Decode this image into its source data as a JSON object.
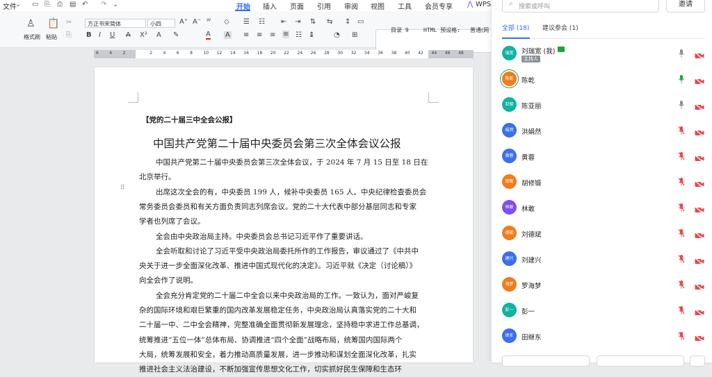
{
  "menubar": {
    "file": "文件",
    "tabs": [
      "开始",
      "插入",
      "页面",
      "引用",
      "审阅",
      "视图",
      "工具",
      "会员专享"
    ],
    "active_tab": "开始",
    "wps_ai": "WPS AI"
  },
  "ribbon": {
    "format_painter": "格式刷",
    "paste": "粘贴",
    "font_name": "方正书宋简体",
    "font_size": "小四",
    "style_name": "目录 9",
    "html_preset_label": "HTML 预设格:",
    "html_preset_value": "普通(网"
  },
  "ruler": {
    "ticks": [
      "6",
      "4",
      "2",
      "",
      "2",
      "4",
      "6",
      "8",
      "10",
      "12",
      "14",
      "16",
      "18",
      "20",
      "22",
      "24",
      "26",
      "28",
      "30",
      "32",
      "34",
      "36",
      "38",
      "40",
      "42",
      "44",
      "46",
      "48"
    ]
  },
  "document": {
    "tag_line": "【党的二十届三中全会公报】",
    "title": "中国共产党第二十届中央委员会第三次全体会议公报",
    "lines": [
      "中国共产党第二十届中央委员会第三次全体会议，于 2024 年 7 月 15 日至 18 日在",
      "北京举行。",
      "出席这次全会的有，中央委员 199 人，候补中央委员 165 人。中央纪律检查委员会",
      "常务委员会委员和有关方面负责同志列席会议。党的二十大代表中部分基层同志和专家",
      "学者也列席了会议。",
      "全会由中央政治局主持。中央委员会总书记习近平作了重要讲话。",
      "全会听取和讨论了习近平受中央政治局委托所作的工作报告，审议通过了《中共中",
      "央关于进一步全面深化改革、推进中国式现代化的决定》。习近平就《决定（讨论稿）》",
      "向全会作了说明。",
      "全会充分肯定党的二十届二中全会以来中央政治局的工作。一致认为，面对严峻复",
      "杂的国际环境和艰巨繁重的国内改革发展稳定任务，中央政治局认真落实党的二十大和",
      "二十届一中、二中全会精神，完整准确全面贯彻新发展理念，坚持稳中求进工作总基调，",
      "统筹推进“五位一体”总体布局、协调推进“四个全面”战略布局，统筹国内国际两个",
      "大局，统筹发展和安全，着力推动高质量发展，进一步推动和谋划全面深化改革，扎实",
      "推进社会主义法治建设，不断加强宣传思想文化工作，切实抓好民生保障和生态环"
    ]
  },
  "sidebar": {
    "search_placeholder": "搜索或呼叫",
    "invite": "邀请",
    "tab_all": "全部 (18)",
    "tab_suggest": "建议参会 (1)",
    "host_badge": "主持人",
    "participants": [
      {
        "avatar": "瑞宽",
        "name": "刘瑞宽 (我)",
        "color": "#12b3a1",
        "mic": "on-gray",
        "host": true
      },
      {
        "avatar": "陈乾",
        "name": "陈乾",
        "color": "#f07c1c",
        "mic": "on-green",
        "ring": true
      },
      {
        "avatar": "亚丽",
        "name": "陈亚丽",
        "color": "#12b3a1",
        "mic": "on-gray"
      },
      {
        "avatar": "娟然",
        "name": "洪娟然",
        "color": "#3a6ff0",
        "mic": "off"
      },
      {
        "avatar": "黄蓉",
        "name": "黄蓉",
        "color": "#3a6ff0",
        "mic": "off"
      },
      {
        "avatar": "修锻",
        "name": "胡修锻",
        "color": "#f07c1c",
        "mic": "off"
      },
      {
        "avatar": "林敢",
        "name": "林敢",
        "color": "#7d4ff0",
        "mic": "off"
      },
      {
        "avatar": "德斌",
        "name": "刘德斌",
        "color": "#f07c1c",
        "mic": "off"
      },
      {
        "avatar": "建兴",
        "name": "刘建兴",
        "color": "#3a6ff0",
        "mic": "off"
      },
      {
        "avatar": "海梦",
        "name": "罗海梦",
        "color": "#f07c1c",
        "mic": "off"
      },
      {
        "avatar": "彭一",
        "name": "彭一",
        "color": "#12b3a1",
        "mic": "off"
      },
      {
        "avatar": "继东",
        "name": "田继东",
        "color": "#3a6ff0",
        "mic": "off"
      }
    ]
  }
}
